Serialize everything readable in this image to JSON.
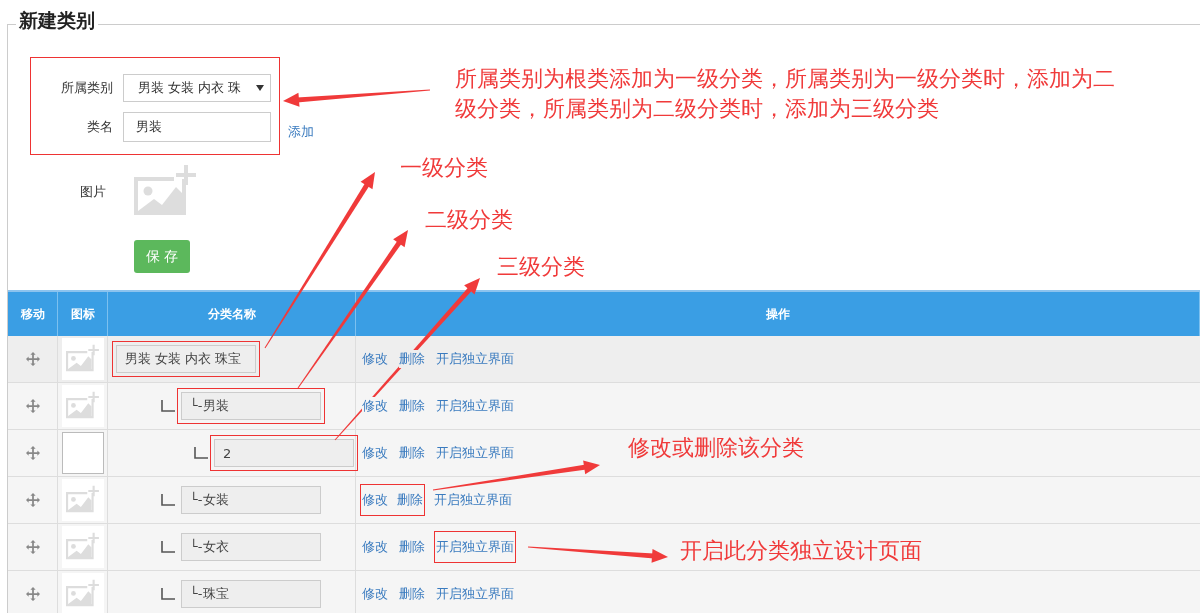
{
  "section_title": "新建类别",
  "form": {
    "highlighted": true,
    "parent_label": "所属类别",
    "parent_value": "男装 女装 内衣 珠",
    "name_label": "类名",
    "name_value": "男装",
    "add_link": "添加",
    "image_label": "图片",
    "save_button": "保 存"
  },
  "table": {
    "columns": [
      "移动",
      "图标",
      "分类名称",
      "操作"
    ],
    "rows": [
      {
        "name": "男装 女装 内衣 珠宝",
        "has_image": true,
        "highlighted": true,
        "actions": [
          {
            "label": "修改",
            "highlighted": false
          },
          {
            "label": "删除",
            "highlighted": false
          },
          {
            "label": "开启独立界面",
            "highlighted": false
          }
        ],
        "children": [
          {
            "name": "└-男装",
            "has_image": true,
            "highlighted": true,
            "actions": [
              {
                "label": "修改",
                "highlighted": false
              },
              {
                "label": "删除",
                "highlighted": false
              },
              {
                "label": "开启独立界面",
                "highlighted": false
              }
            ],
            "children": [
              {
                "name": "2",
                "has_image": false,
                "highlighted": true,
                "actions": [
                  {
                    "label": "修改",
                    "highlighted": false
                  },
                  {
                    "label": "删除",
                    "highlighted": false
                  },
                  {
                    "label": "开启独立界面",
                    "highlighted": false
                  }
                ]
              }
            ]
          },
          {
            "name": "└-女装",
            "has_image": true,
            "highlighted": false,
            "actions": [
              {
                "label": "修改",
                "highlighted": true
              },
              {
                "label": "删除",
                "highlighted": true
              },
              {
                "label": "开启独立界面",
                "highlighted": false
              }
            ]
          },
          {
            "name": "└-女衣",
            "has_image": true,
            "highlighted": false,
            "actions": [
              {
                "label": "修改",
                "highlighted": false
              },
              {
                "label": "删除",
                "highlighted": false
              },
              {
                "label": "开启独立界面",
                "highlighted": true
              }
            ]
          },
          {
            "name": "└-珠宝",
            "has_image": true,
            "highlighted": false,
            "actions": [
              {
                "label": "修改",
                "highlighted": false
              },
              {
                "label": "删除",
                "highlighted": false
              },
              {
                "label": "开启独立界面",
                "highlighted": false
              }
            ]
          }
        ]
      }
    ]
  },
  "annotations": [
    {
      "text": "所属类别为根类添加为一级分类，所属类别为一级分类时，添加为二级分类，所属类别为二级分类时，添加为三级分类"
    },
    {
      "text": "一级分类"
    },
    {
      "text": "二级分类"
    },
    {
      "text": "三级分类"
    },
    {
      "text": "修改或删除该分类"
    },
    {
      "text": "开启此分类独立设计页面"
    }
  ]
}
